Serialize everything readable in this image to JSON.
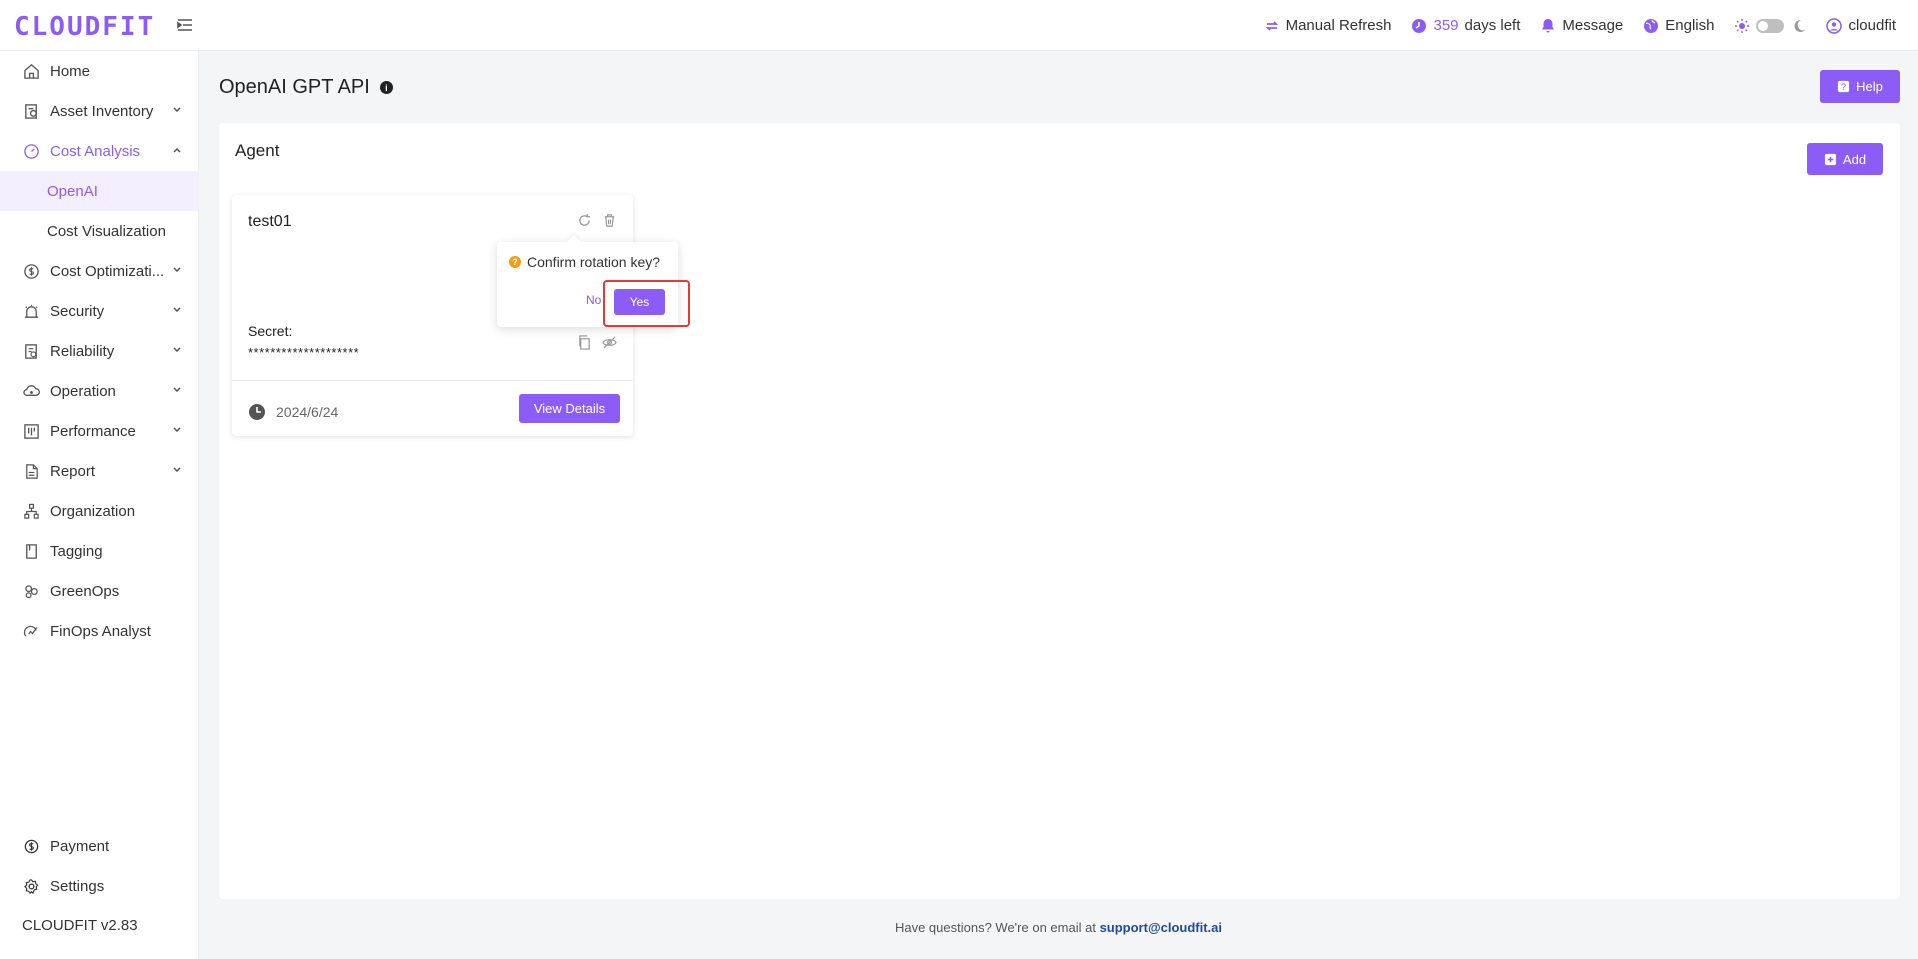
{
  "brand": {
    "logo": "CLOUDFIT",
    "accent": "#8b5cf6"
  },
  "topbar": {
    "refresh": "Manual Refresh",
    "days_count": "359",
    "days_text": "days left",
    "message": "Message",
    "language": "English",
    "user": "cloudfit"
  },
  "sidebar": {
    "items": [
      {
        "label": "Home",
        "icon": "home-icon"
      },
      {
        "label": "Asset Inventory",
        "icon": "inventory-icon"
      },
      {
        "label": "Cost Analysis",
        "icon": "dashboard-icon"
      },
      {
        "label": "OpenAI"
      },
      {
        "label": "Cost Visualization"
      },
      {
        "label": "Cost Optimizati...",
        "icon": "dollar-icon"
      },
      {
        "label": "Security",
        "icon": "alarm-icon"
      },
      {
        "label": "Reliability",
        "icon": "reliability-icon"
      },
      {
        "label": "Operation",
        "icon": "cloud-icon"
      },
      {
        "label": "Performance",
        "icon": "performance-icon"
      },
      {
        "label": "Report",
        "icon": "report-icon"
      },
      {
        "label": "Organization",
        "icon": "org-icon"
      },
      {
        "label": "Tagging",
        "icon": "tag-icon"
      },
      {
        "label": "GreenOps",
        "icon": "leaf-icon"
      },
      {
        "label": "FinOps Analyst",
        "icon": "analyst-icon"
      }
    ],
    "payment": "Payment",
    "settings": "Settings",
    "version": "CLOUDFIT v2.83"
  },
  "main": {
    "title": "OpenAI GPT API",
    "help": "Help",
    "panel_title": "Agent",
    "add": "Add",
    "card": {
      "name": "test01",
      "secret_label": "Secret:",
      "secret_value": "********************",
      "date": "2024/6/24",
      "view": "View Details"
    },
    "popconfirm": {
      "message": "Confirm rotation key?",
      "no": "No",
      "yes": "Yes"
    }
  },
  "footer": {
    "text": "Have questions? We're on email at",
    "email": "support@cloudfit.ai"
  }
}
